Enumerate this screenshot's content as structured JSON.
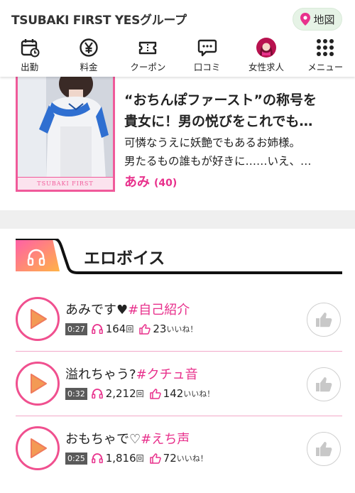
{
  "header": {
    "site_title": "TSUBAKI FIRST YESグループ",
    "map_label": "地図",
    "nav": [
      {
        "label": "出勤",
        "icon": "calendar-icon"
      },
      {
        "label": "料金",
        "icon": "yen-icon"
      },
      {
        "label": "クーポン",
        "icon": "coupon-icon"
      },
      {
        "label": "口コミ",
        "icon": "comment-icon"
      },
      {
        "label": "女性求人",
        "icon": "female-avatar-icon"
      },
      {
        "label": "メニュー",
        "icon": "grid-menu-icon"
      }
    ]
  },
  "profile": {
    "photo_label": "TSUBAKI FIRST",
    "title_lines": [
      "“おちんぽファースト”の称号を",
      "貴女に！男の悦びをこれでも…"
    ],
    "desc_lines": [
      "可憐なうえに妖艶でもあるお姉様。",
      "男たるもの誰もが好きに……いえ、…"
    ],
    "name": "あみ",
    "age": "(40)"
  },
  "voice_section": {
    "title": "エロボイス",
    "items": [
      {
        "title": "あみです♥",
        "tag": "#自己紹介",
        "duration": "0:27",
        "plays": "164",
        "plays_suffix": "回",
        "likes": "23",
        "likes_suffix": "いいね！"
      },
      {
        "title": "溢れちゃう?",
        "tag": "#クチュ音",
        "duration": "0:32",
        "plays": "2,212",
        "plays_suffix": "回",
        "likes": "142",
        "likes_suffix": "いいね！"
      },
      {
        "title": "おもちゃで♡",
        "tag": "#えち声",
        "duration": "0:25",
        "plays": "1,816",
        "plays_suffix": "回",
        "likes": "72",
        "likes_suffix": "いいね！"
      }
    ]
  },
  "colors": {
    "accent": "#e8318c",
    "play_border": "#f0508f",
    "divider": "#f3a9c9"
  }
}
